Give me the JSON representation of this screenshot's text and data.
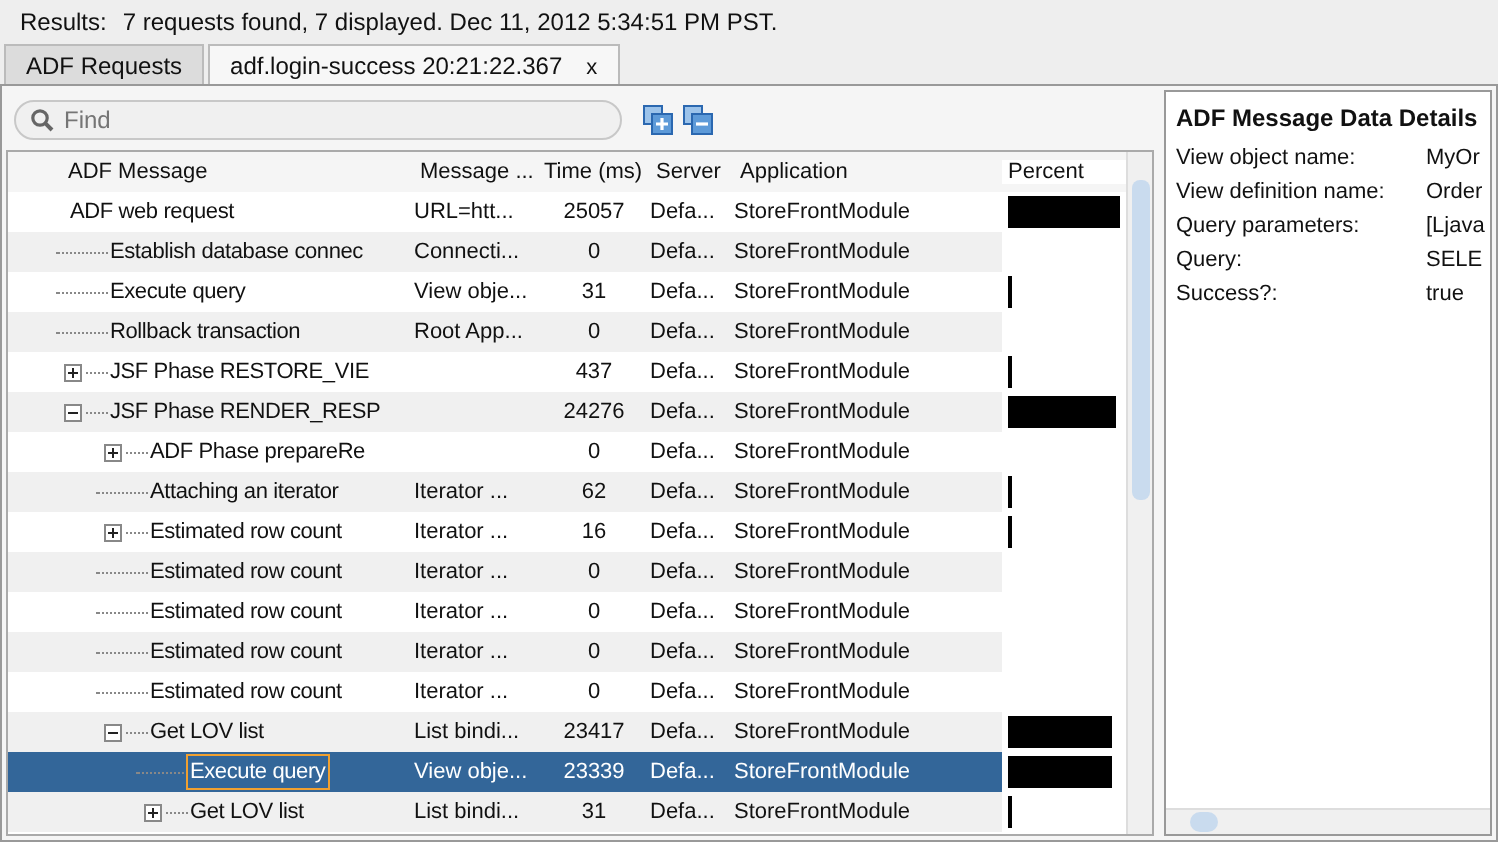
{
  "status_bar": {
    "label": "Results:",
    "text": "7 requests found, 7 displayed.  Dec 11, 2012 5:34:51 PM PST."
  },
  "tabs": [
    {
      "label": "ADF Requests",
      "selected": false
    },
    {
      "label": "adf.login-success  20:21:22.367",
      "close": "x",
      "selected": true
    }
  ],
  "search": {
    "placeholder": "Find"
  },
  "table": {
    "columns": [
      "ADF Message",
      "Message ...",
      "Time (ms)",
      "Server",
      "Application",
      "Percent"
    ],
    "rows": [
      {
        "message": "ADF web request",
        "message_type": "URL=htt...",
        "time": "25057",
        "server": "Defa...",
        "application": "StoreFrontModule",
        "level": 1.0,
        "selected": false,
        "children": [
          {
            "message": "Establish database connec",
            "message_type": "Connecti...",
            "time": "0",
            "server": "Defa...",
            "application": "StoreFrontModule",
            "selected": false
          },
          {
            "message": "Execute query",
            "message_type": "View obje...",
            "time": "31",
            "server": "Defa...",
            "application": "StoreFrontModule",
            "level": 0.01,
            "selected": false
          },
          {
            "message": "Rollback transaction",
            "message_type": "Root App...",
            "time": "0",
            "server": "Defa...",
            "application": "StoreFrontModule",
            "selected": false
          },
          {
            "message": "JSF Phase RESTORE_VIE",
            "time": "437",
            "server": "Defa...",
            "application": "StoreFrontModule",
            "level": 0.02,
            "expanded": false,
            "selected": false
          },
          {
            "message": "JSF Phase RENDER_RESP",
            "time": "24276",
            "server": "Defa...",
            "application": "StoreFrontModule",
            "level": 0.97,
            "expanded": true,
            "selected": false,
            "children": [
              {
                "message": "ADF Phase prepareRe",
                "time": "0",
                "server": "Defa...",
                "application": "StoreFrontModule",
                "expanded": false,
                "selected": false
              },
              {
                "message": "Attaching an iterator",
                "message_type": "Iterator ...",
                "time": "62",
                "server": "Defa...",
                "application": "StoreFrontModule",
                "level": 0.01,
                "selected": false
              },
              {
                "message": "Estimated row count",
                "message_type": "Iterator ...",
                "time": "16",
                "server": "Defa...",
                "application": "StoreFrontModule",
                "level": 0.01,
                "expanded": false,
                "selected": false
              },
              {
                "message": "Estimated row count",
                "message_type": "Iterator ...",
                "time": "0",
                "server": "Defa...",
                "application": "StoreFrontModule",
                "selected": false
              },
              {
                "message": "Estimated row count",
                "message_type": "Iterator ...",
                "time": "0",
                "server": "Defa...",
                "application": "StoreFrontModule",
                "selected": false
              },
              {
                "message": "Estimated row count",
                "message_type": "Iterator ...",
                "time": "0",
                "server": "Defa...",
                "application": "StoreFrontModule",
                "selected": false
              },
              {
                "message": "Estimated row count",
                "message_type": "Iterator ...",
                "time": "0",
                "server": "Defa...",
                "application": "StoreFrontModule",
                "selected": false
              },
              {
                "message": "Get LOV list",
                "message_type": "List bindi...",
                "time": "23417",
                "server": "Defa...",
                "application": "StoreFrontModule",
                "level": 0.93,
                "expanded": true,
                "selected": false,
                "children": [
                  {
                    "message": "Execute query",
                    "message_type": "View obje...",
                    "time": "23339",
                    "server": "Defa...",
                    "application": "StoreFrontModule",
                    "level": 0.93,
                    "selected": true
                  },
                  {
                    "message": "Get LOV list",
                    "message_type": "List bindi...",
                    "time": "31",
                    "server": "Defa...",
                    "application": "StoreFrontModule",
                    "level": 0.01,
                    "expanded": false,
                    "selected": false
                  }
                ]
              }
            ]
          }
        ]
      }
    ]
  },
  "details": {
    "title": "ADF Message Data Details",
    "fields": [
      {
        "label": "View object name:",
        "value": "MyOr"
      },
      {
        "label": "View definition name:",
        "value": "Order"
      },
      {
        "label": "Query parameters:",
        "value": "[Ljava"
      },
      {
        "label": "Query:",
        "value": "SELE"
      },
      {
        "label": "Success?:",
        "value": "true"
      }
    ]
  }
}
